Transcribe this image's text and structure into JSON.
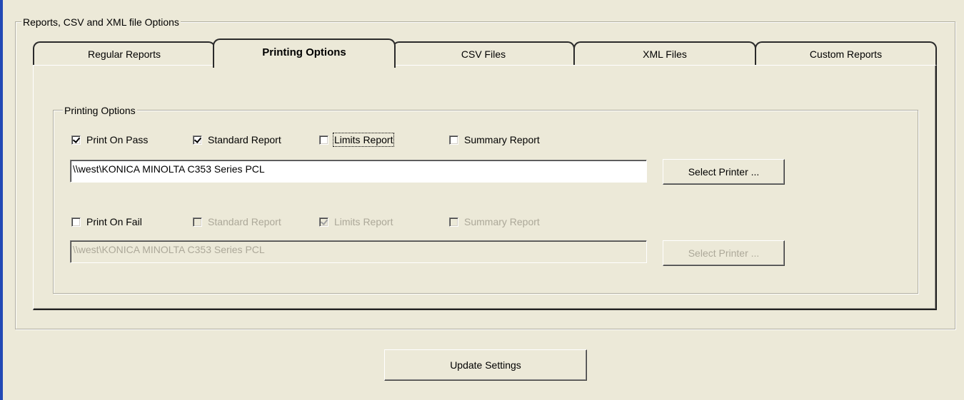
{
  "outer_group": {
    "title": "Reports, CSV and XML file Options"
  },
  "tabs": [
    {
      "label": "Regular Reports"
    },
    {
      "label": "Printing Options"
    },
    {
      "label": "CSV Files"
    },
    {
      "label": "XML Files"
    },
    {
      "label": "Custom Reports"
    }
  ],
  "active_tab": "Printing Options",
  "printing_group": {
    "title": "Printing Options"
  },
  "pass_row": {
    "print_on_pass": {
      "label": "Print On Pass",
      "checked": true
    },
    "standard_report": {
      "label": "Standard Report",
      "checked": true
    },
    "limits_report": {
      "label": "Limits Report",
      "checked": false
    },
    "summary_report": {
      "label": "Summary Report",
      "checked": false
    },
    "printer": "\\\\west\\KONICA MINOLTA C353 Series PCL",
    "select_printer_label": "Select Printer ..."
  },
  "fail_row": {
    "print_on_fail": {
      "label": "Print On Fail",
      "checked": false
    },
    "standard_report": {
      "label": "Standard Report",
      "checked": false
    },
    "limits_report": {
      "label": "Limits Report",
      "checked": true
    },
    "summary_report": {
      "label": "Summary Report",
      "checked": false
    },
    "printer": "\\\\west\\KONICA MINOLTA C353 Series PCL",
    "select_printer_label": "Select Printer ..."
  },
  "update_settings_label": "Update Settings",
  "colors": {
    "left_accent": "#2249B5",
    "dialog_bg": "#ECE9D8",
    "disabled_text": "#ACA899"
  }
}
